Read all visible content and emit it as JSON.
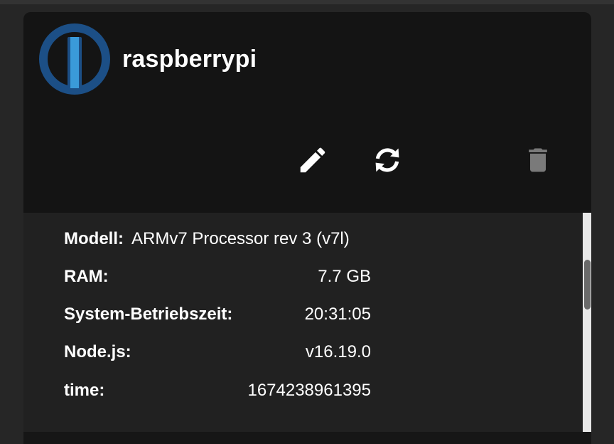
{
  "device": {
    "name": "raspberrypi"
  },
  "actions": {
    "edit_icon": "pencil-icon",
    "refresh_icon": "refresh-icon",
    "delete_icon": "trash-icon"
  },
  "info": {
    "rows": [
      {
        "label": "Modell:",
        "value": "ARMv7 Processor rev 3 (v7l)"
      },
      {
        "label": "RAM:",
        "value": "7.7 GB"
      },
      {
        "label": "System-Betriebszeit:",
        "value": "20:31:05"
      },
      {
        "label": "Node.js:",
        "value": "v16.19.0"
      },
      {
        "label": "time:",
        "value": "1674238961395"
      }
    ]
  },
  "colors": {
    "logo_blue_dark": "#1c4f86",
    "logo_blue_light": "#3a9ad9",
    "card_bg": "#141414",
    "info_bg": "#212121",
    "delete_disabled": "#7a7a7a"
  }
}
